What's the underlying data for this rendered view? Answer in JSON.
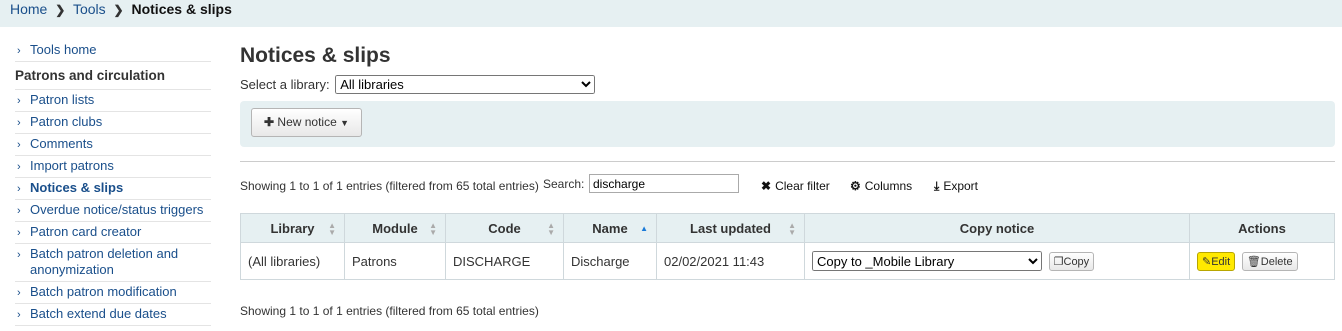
{
  "breadcrumb": [
    {
      "label": "Home"
    },
    {
      "label": "Tools"
    },
    {
      "label": "Notices & slips"
    }
  ],
  "sidebar": {
    "top_item": "Tools home",
    "section_title": "Patrons and circulation",
    "items": [
      "Patron lists",
      "Patron clubs",
      "Comments",
      "Import patrons",
      "Notices & slips",
      "Overdue notice/status triggers",
      "Patron card creator",
      "Batch patron deletion and anonymization",
      "Batch patron modification",
      "Batch extend due dates"
    ],
    "active_item": "Notices & slips"
  },
  "page": {
    "title": "Notices & slips",
    "library_label": "Select a library:",
    "library_value": "All libraries",
    "new_notice_label": "New notice"
  },
  "table_controls": {
    "showing": "Showing 1 to 1 of 1 entries (filtered from 65 total entries)",
    "search_label": "Search:",
    "search_value": "discharge",
    "clear_filter": "Clear filter",
    "columns": "Columns",
    "export": "Export"
  },
  "table": {
    "headers": [
      "Library",
      "Module",
      "Code",
      "Name",
      "Last updated",
      "Copy notice",
      "Actions"
    ],
    "rows": [
      {
        "library": "(All libraries)",
        "module": "Patrons",
        "code": "DISCHARGE",
        "name": "Discharge",
        "last_updated": "02/02/2021 11:43",
        "copy_to": "Copy to _Mobile Library",
        "copy_button": "Copy",
        "edit_button": "Edit",
        "delete_button": "Delete"
      }
    ]
  },
  "footer": {
    "showing": "Showing 1 to 1 of 1 entries (filtered from 65 total entries)"
  }
}
